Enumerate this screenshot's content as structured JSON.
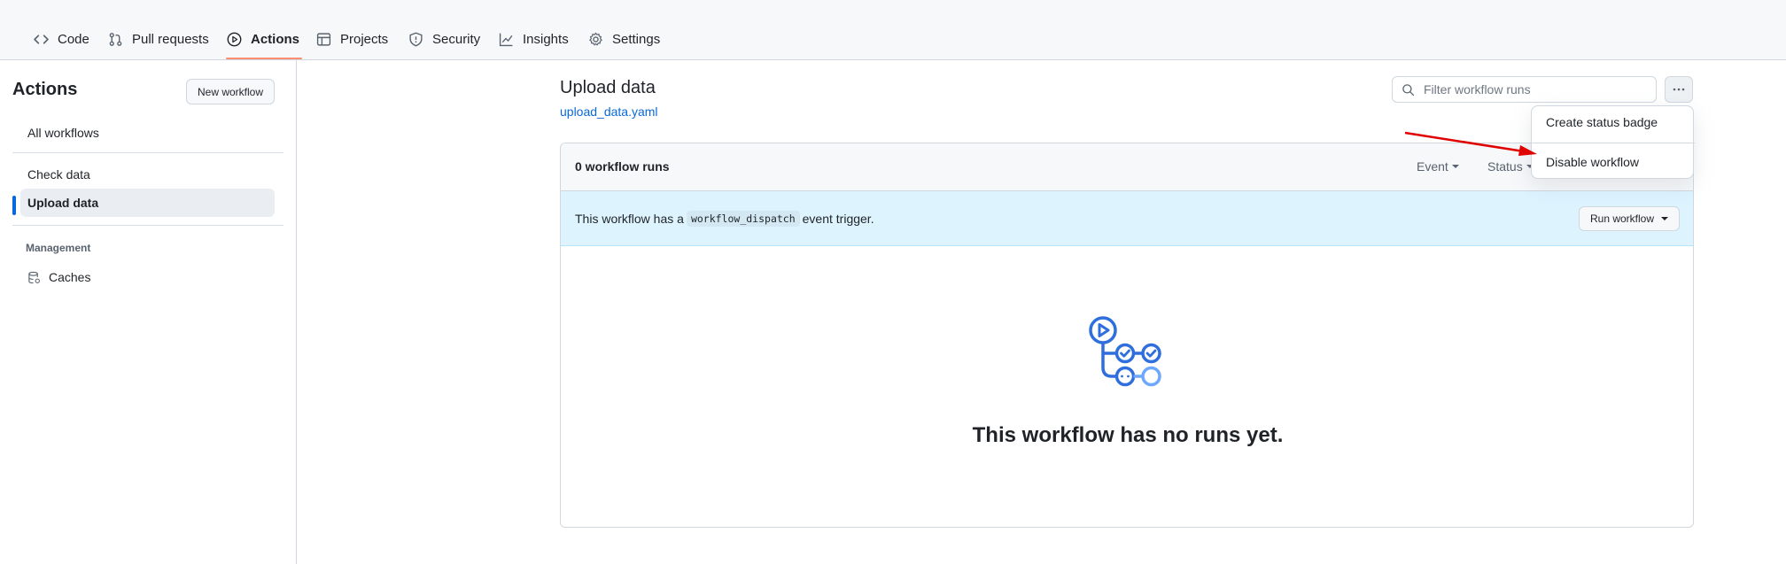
{
  "nav": {
    "tabs": [
      {
        "label": "Code",
        "icon": "code-icon"
      },
      {
        "label": "Pull requests",
        "icon": "pull-request-icon"
      },
      {
        "label": "Actions",
        "icon": "play-icon"
      },
      {
        "label": "Projects",
        "icon": "table-icon"
      },
      {
        "label": "Security",
        "icon": "shield-icon"
      },
      {
        "label": "Insights",
        "icon": "graph-icon"
      },
      {
        "label": "Settings",
        "icon": "gear-icon"
      }
    ],
    "active_tab": "Actions"
  },
  "sidebar": {
    "title": "Actions",
    "new_workflow_label": "New workflow",
    "all_workflows_label": "All workflows",
    "workflows": [
      {
        "label": "Check data"
      },
      {
        "label": "Upload data"
      }
    ],
    "selected_workflow": "Upload data",
    "management_heading": "Management",
    "caches_label": "Caches"
  },
  "main": {
    "title": "Upload data",
    "file_link": "upload_data.yaml",
    "filter_placeholder": "Filter workflow runs",
    "runs_count": "0 workflow runs",
    "event_filter": "Event",
    "status_filter": "Status",
    "dispatch_prefix": "This workflow has a",
    "dispatch_code": "workflow_dispatch",
    "dispatch_suffix": "event trigger.",
    "run_workflow_label": "Run workflow",
    "empty_text": "This workflow has no runs yet."
  },
  "menu": {
    "items": [
      {
        "label": "Create status badge"
      },
      {
        "label": "Disable workflow"
      }
    ]
  },
  "colors": {
    "accent": "#0969da",
    "tab_underline": "#fd8c73",
    "dispatch_bg": "#ddf4ff",
    "annotation_arrow": "#e00000"
  }
}
